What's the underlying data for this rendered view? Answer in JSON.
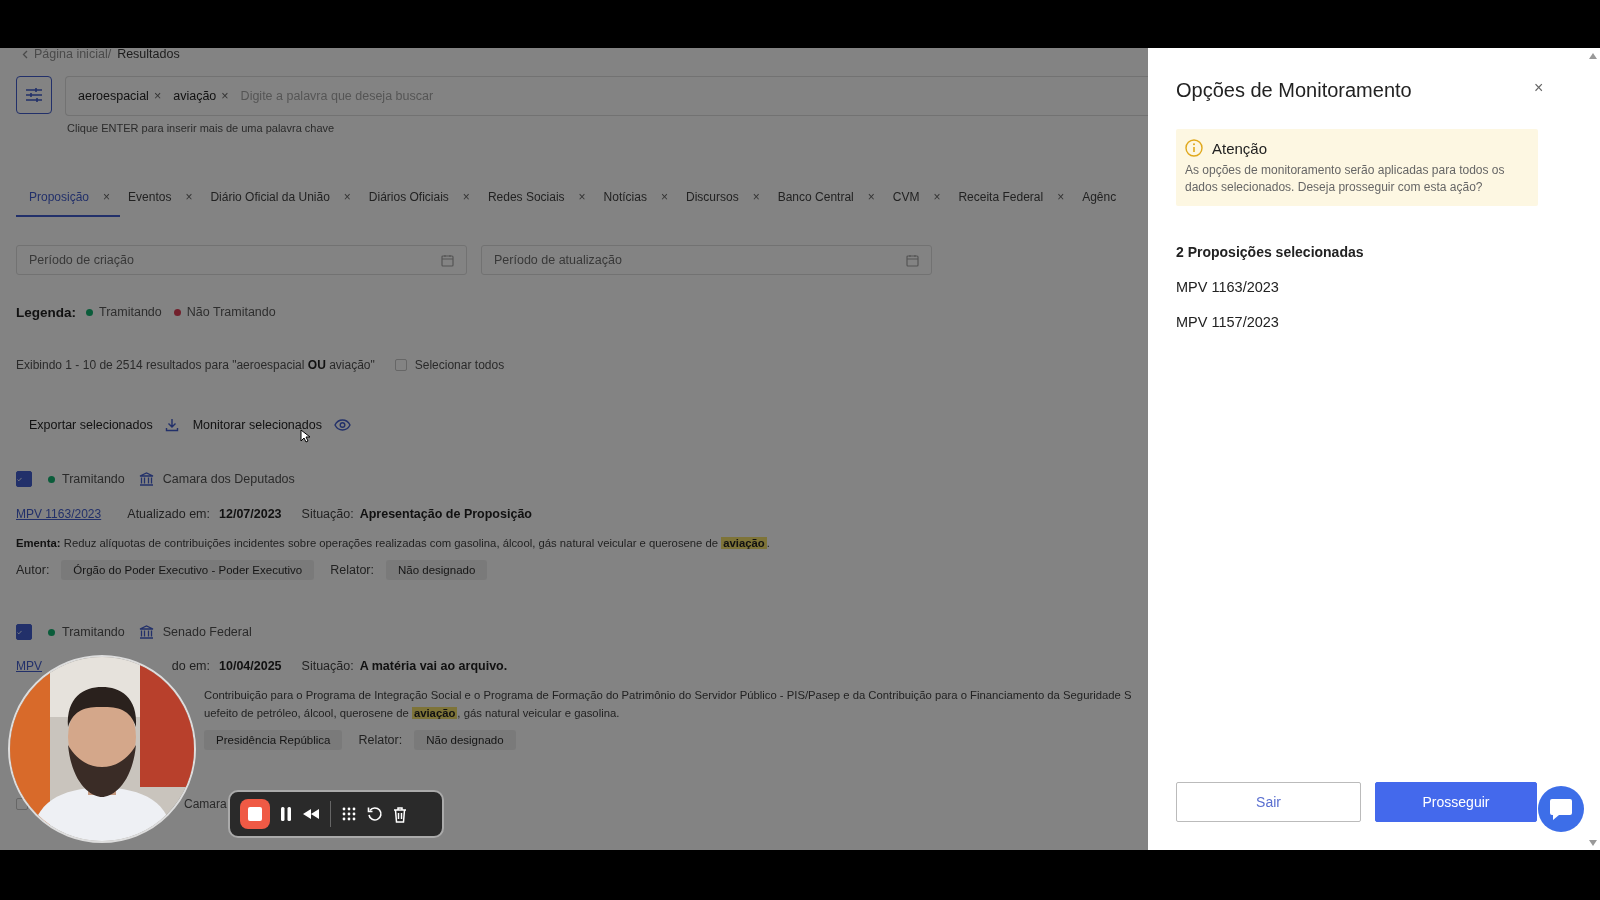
{
  "breadcrumb": {
    "items": [
      "Página inicial/",
      "Resultados"
    ]
  },
  "search": {
    "chips": [
      {
        "label": "aeroespacial",
        "remove": "×"
      },
      {
        "label": "aviação",
        "remove": "×"
      }
    ],
    "placeholder": "Digite a palavra que deseja buscar",
    "hint": "Clique ENTER para inserir mais de uma palavra chave"
  },
  "tabs": [
    {
      "label": "Proposição",
      "close": "×",
      "selected": true
    },
    {
      "label": "Eventos",
      "close": "×",
      "selected": false
    },
    {
      "label": "Diário Oficial da União",
      "close": "×",
      "selected": false
    },
    {
      "label": "Diários Oficiais",
      "close": "×",
      "selected": false
    },
    {
      "label": "Redes Sociais",
      "close": "×",
      "selected": false
    },
    {
      "label": "Notícias",
      "close": "×",
      "selected": false
    },
    {
      "label": "Discursos",
      "close": "×",
      "selected": false
    },
    {
      "label": "Banco Central",
      "close": "×",
      "selected": false
    },
    {
      "label": "CVM",
      "close": "×",
      "selected": false
    },
    {
      "label": "Receita Federal",
      "close": "×",
      "selected": false
    },
    {
      "label": "Agênc",
      "selected": false
    }
  ],
  "date_filters": [
    {
      "placeholder": "Período de criação"
    },
    {
      "placeholder": "Período de atualização"
    }
  ],
  "legend": {
    "label": "Legenda:",
    "items": [
      {
        "label": "Tramitando",
        "color": "#0a5c3a"
      },
      {
        "label": "Não Tramitando",
        "color": "#72202c"
      }
    ]
  },
  "results": {
    "summary": "Exibindo 1 - 10 de 2514 resultados para  \"aeroespacial **OU** aviação\"",
    "select_all": {
      "label": "Selecionar todos",
      "checked": false
    }
  },
  "actions": [
    {
      "label": "Exportar selecionados",
      "kind": "export"
    },
    {
      "label": "Monitorar selecionados",
      "kind": "monitor"
    }
  ],
  "items": [
    {
      "checked": true,
      "status": {
        "label": "Tramitando",
        "color": "#0a5c3a"
      },
      "source": "Camara dos Deputados",
      "code": "MPV 1163/2023",
      "updated_label": "Atualizado em:",
      "updated": "12/07/2023",
      "situation_label": "Situação:",
      "situation": "Apresentação de Proposição",
      "ementa_label": "Ementa:",
      "ementa": [
        "Reduz alíquotas de contribuições incidentes sobre operações realizadas com gasolina, álcool, gás natural veicular e querosene de **aviação**."
      ],
      "author_label": "Autor:",
      "author": "Órgão do Poder Executivo - Poder Executivo",
      "relator_label": "Relator:",
      "relator": "Não designado"
    },
    {
      "checked": true,
      "status": {
        "label": "Tramitando",
        "color": "#0a5c3a"
      },
      "source": "Senado Federal",
      "code": "MPV",
      "updated_label": "do em:",
      "updated": "10/04/2025",
      "situation_label": "Situação:",
      "situation": "A matéria vai ao arquivo.",
      "ementa": [
        "Contribuição para o Programa de Integração Social e o Programa de Formação do Patrimônio do Servidor Público - PIS/Pasep e da Contribuição para o Financiamento da Seguridade S",
        "uefeito de petróleo, álcool, querosene de **aviação**, gás natural veicular e gasolina."
      ],
      "author": "Presidência República",
      "relator_label": "Relator:",
      "relator": "Não designado"
    },
    {
      "checked": false,
      "source": "Camara"
    }
  ],
  "drawer": {
    "title": "Opções de Monitoramento",
    "close": "×",
    "alert": {
      "title": "Atenção",
      "text": "As opções de monitoramento serão aplicadas para todos os dados selecionados. Deseja prosseguir com esta ação?"
    },
    "selected_heading": "2 Proposições selecionadas",
    "selected": [
      "MPV 1163/2023",
      "MPV 1157/2023"
    ],
    "buttons": [
      {
        "label": "Sair",
        "kind": "secondary"
      },
      {
        "label": "Prosseguir",
        "kind": "primary"
      }
    ]
  }
}
